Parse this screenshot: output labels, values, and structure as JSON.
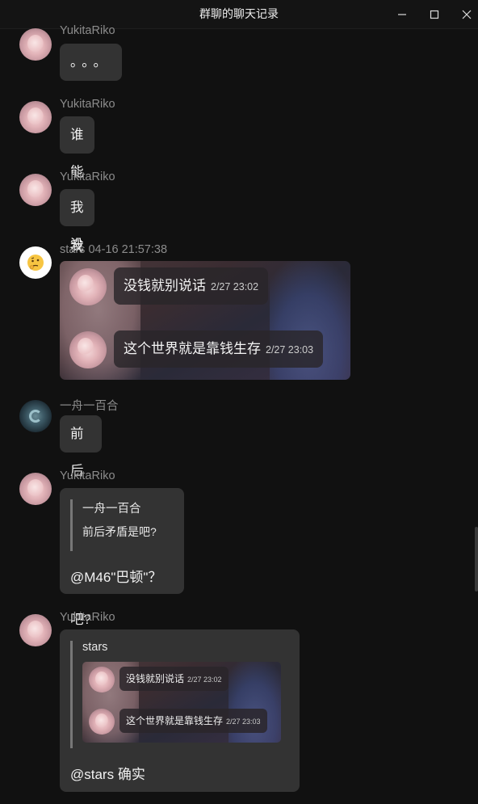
{
  "window": {
    "title": "群聊的聊天记录",
    "controls": {
      "minimize": "minimize-icon",
      "maximize": "maximize-icon",
      "close": "close-icon"
    }
  },
  "messages": [
    {
      "sender": "YukitaRiko",
      "text": "。。。"
    },
    {
      "sender": "YukitaRiko",
      "text": "谁能替我报销"
    },
    {
      "sender": "YukitaRiko",
      "text": "我没有钱了"
    },
    {
      "sender": "stars 04-16 21:57:38",
      "forwarded": [
        {
          "text": "没钱就别说话",
          "time": "2/27 23:02"
        },
        {
          "text": "这个世界就是靠钱生存",
          "time": "2/27 23:03"
        }
      ]
    },
    {
      "sender": "一舟一百合",
      "text": "前后矛盾是吧?"
    },
    {
      "sender": "YukitaRiko",
      "quote": {
        "name": "一舟一百合",
        "text": "前后矛盾是吧?"
      },
      "text": "@M46\"巴顿\"？"
    },
    {
      "sender": "YukitaRiko",
      "quote": {
        "name": "stars",
        "forwarded": [
          {
            "text": "没钱就别说话",
            "time": "2/27 23:02"
          },
          {
            "text": "这个世界就是靠钱生存",
            "time": "2/27 23:03"
          }
        ]
      },
      "text": "@stars 确实"
    }
  ],
  "icons": {
    "stars_avatar": "thinking-face-emoji"
  }
}
